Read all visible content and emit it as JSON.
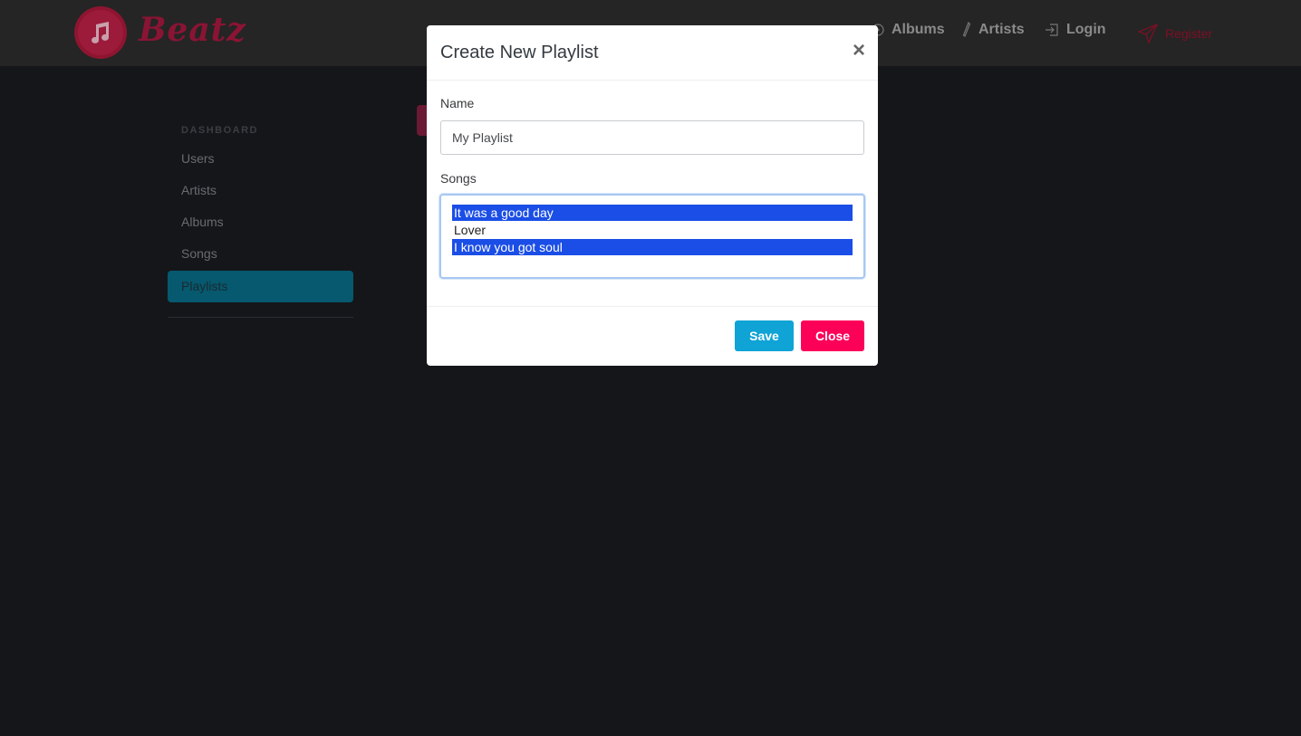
{
  "brand": {
    "name": "Beatz"
  },
  "nav": {
    "albums": "Albums",
    "artists": "Artists",
    "login": "Login",
    "register": "Register"
  },
  "sidebar": {
    "heading": "DASHBOARD",
    "items": [
      {
        "label": "Users"
      },
      {
        "label": "Artists"
      },
      {
        "label": "Albums"
      },
      {
        "label": "Songs"
      },
      {
        "label": "Playlists",
        "active": true
      }
    ]
  },
  "modal": {
    "title": "Create New Playlist",
    "close_symbol": "×",
    "name_label": "Name",
    "name_value": "My Playlist",
    "songs_label": "Songs",
    "songs": [
      {
        "label": "It was a good day",
        "selected": true
      },
      {
        "label": "Lover",
        "selected": false
      },
      {
        "label": "I know you got soul",
        "selected": true
      }
    ],
    "save_label": "Save",
    "close_label": "Close"
  },
  "colors": {
    "accent_primary": "#0fa3d6",
    "accent_danger": "#fc0158",
    "selection": "#1b4ee6",
    "sidebar_active": "#06596e"
  }
}
